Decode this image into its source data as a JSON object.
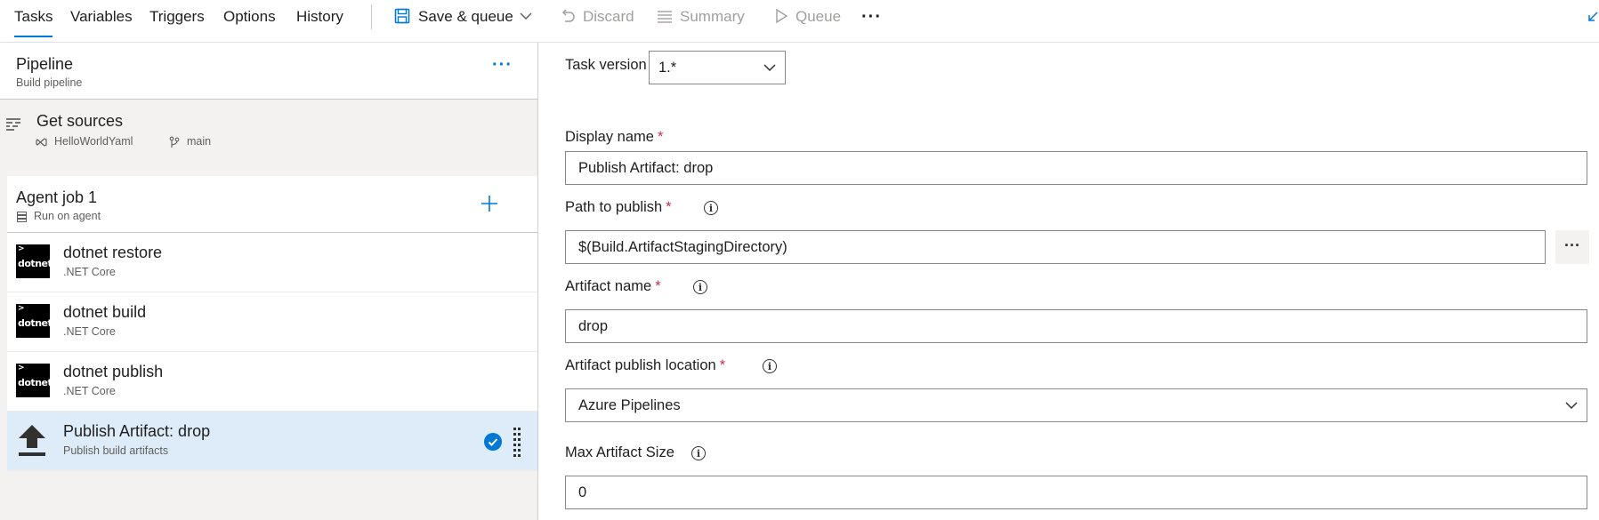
{
  "toolbar": {
    "tabs": [
      "Tasks",
      "Variables",
      "Triggers",
      "Options",
      "History"
    ],
    "save_queue": "Save & queue",
    "discard": "Discard",
    "summary": "Summary",
    "queue": "Queue",
    "more": "···"
  },
  "pipeline": {
    "title": "Pipeline",
    "subtitle": "Build pipeline",
    "more": "···"
  },
  "get_sources": {
    "title": "Get sources",
    "repo": "HelloWorldYaml",
    "branch": "main"
  },
  "agent_job": {
    "title": "Agent job 1",
    "subtitle": "Run on agent"
  },
  "tasks": [
    {
      "name": "dotnet restore",
      "sub": ".NET Core",
      "logo": "dotnet"
    },
    {
      "name": "dotnet build",
      "sub": ".NET Core",
      "logo": "dotnet"
    },
    {
      "name": "dotnet publish",
      "sub": ".NET Core",
      "logo": "dotnet"
    },
    {
      "name": "Publish Artifact: drop",
      "sub": "Publish build artifacts",
      "logo": "upload-icon"
    }
  ],
  "form": {
    "task_version_label": "Task version",
    "task_version_value": "1.*",
    "display_name_label": "Display name",
    "display_name_value": "Publish Artifact: drop",
    "path_label": "Path to publish",
    "path_value": "$(Build.ArtifactStagingDirectory)",
    "path_browse": "···",
    "artifact_name_label": "Artifact name",
    "artifact_name_value": "drop",
    "location_label": "Artifact publish location",
    "location_value": "Azure Pipelines",
    "max_size_label": "Max Artifact Size",
    "max_size_value": "0",
    "required_mark": "*"
  },
  "colors": {
    "accent": "#0078d4",
    "required": "#c4314b",
    "selected_bg": "#deecf9"
  }
}
